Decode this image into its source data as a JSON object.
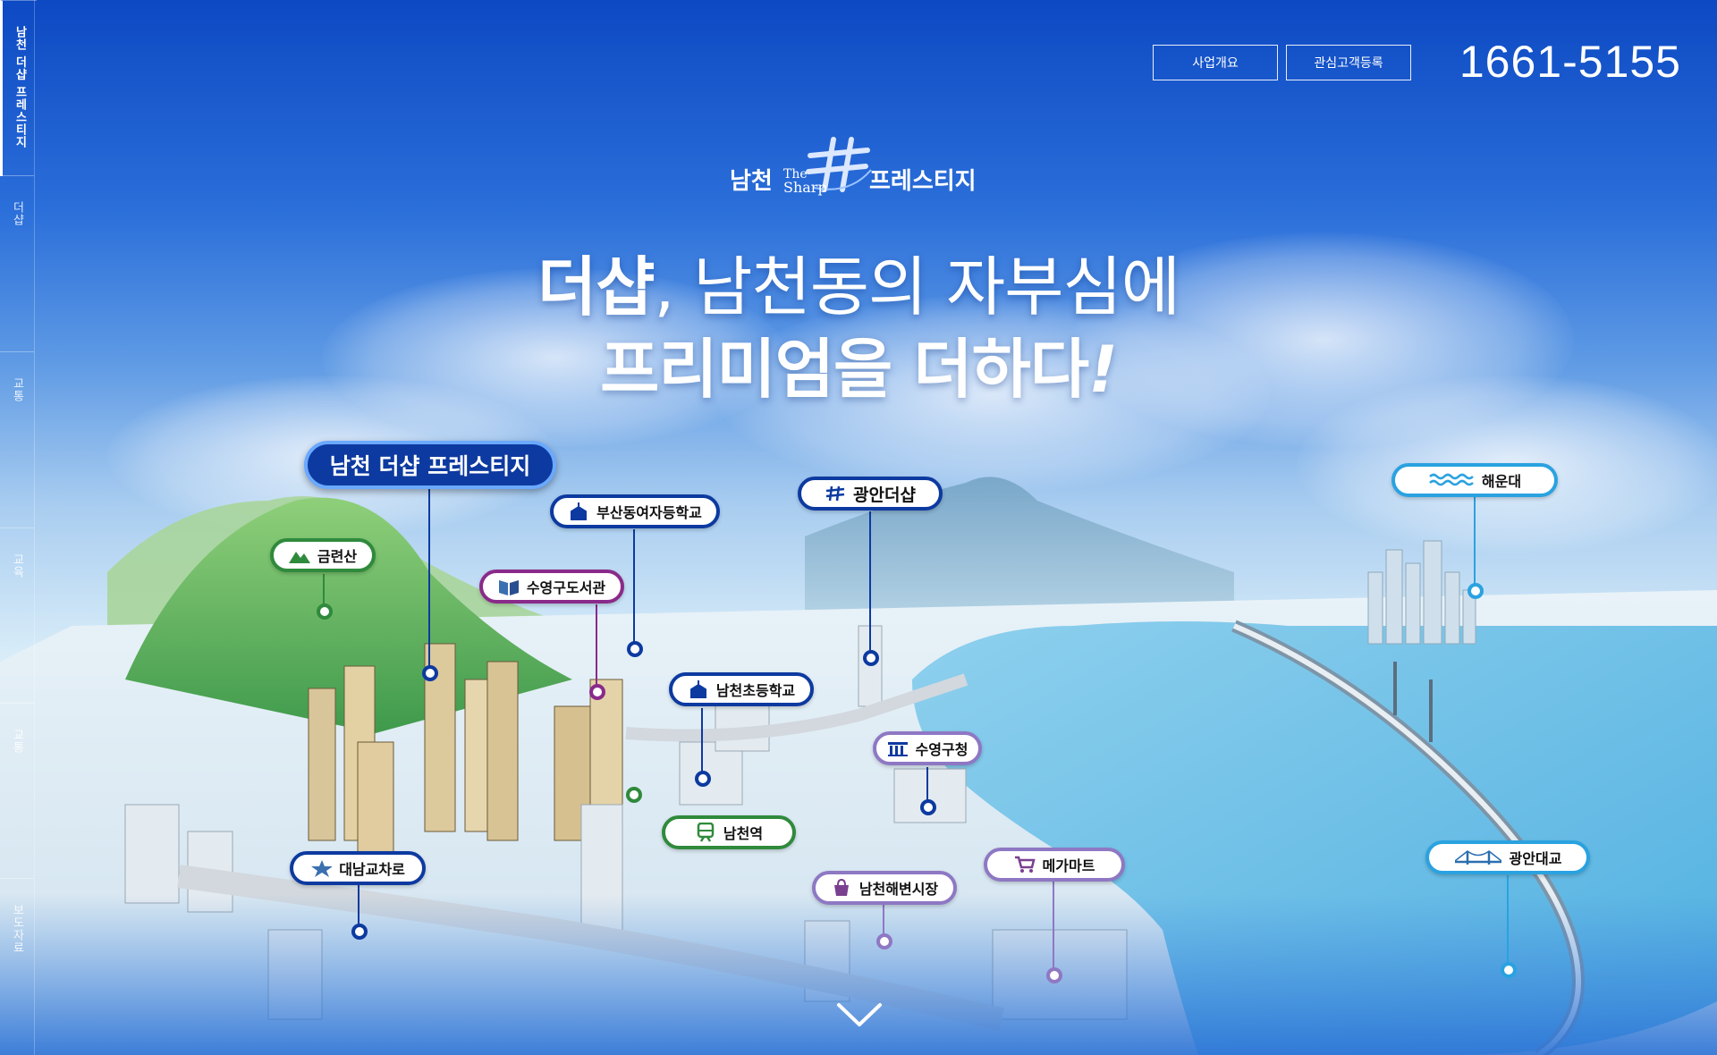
{
  "sidenav": {
    "items": [
      {
        "label": "남천 더샵 프레스티지",
        "active": true
      },
      {
        "label": "더샵",
        "active": false
      },
      {
        "label": "교통",
        "active": false
      },
      {
        "label": "교육",
        "active": false
      },
      {
        "label": "교통",
        "active": false
      },
      {
        "label": "보도자료",
        "active": false
      }
    ]
  },
  "header": {
    "btn_overview": "사업개요",
    "btn_register": "관심고객등록",
    "phone": "1661-5155"
  },
  "logo": {
    "left": "남천",
    "the": "The",
    "sharp": "Sharp",
    "right": "프레스티지"
  },
  "headline": {
    "line1_bold": "더샵",
    "line1_rest": ", 남천동의 자부심에",
    "line2_main": "프리미엄을 더하다",
    "line2_excl": "!"
  },
  "map_labels": {
    "main": "남천 더샵 프레스티지",
    "geumnyeonsan": "금련산",
    "busan_girls_hs": "부산동여자등학교",
    "suyeong_library": "수영구도서관",
    "gwangan_thesharp": "광안더샵",
    "namcheon_elem": "남천초등학교",
    "suyeong_office": "수영구청",
    "namcheon_station": "남천역",
    "daenamgyocharo": "대남교차로",
    "namcheon_market": "남천해변시장",
    "megamart": "메가마트",
    "haeundae": "해운대",
    "gwangan_bridge": "광안대교"
  },
  "icons": {
    "mountain": "mountain-icon",
    "school": "school-icon",
    "book": "book-icon",
    "sharp_logo": "sharp-logo-icon",
    "government": "building-icon",
    "train": "train-icon",
    "interchange": "star-icon",
    "shopping_bag": "bag-icon",
    "cart": "cart-icon",
    "wave": "wave-icon",
    "bridge": "bridge-icon",
    "scroll": "chevron-down-icon"
  },
  "colors": {
    "green": "#2f8a3c",
    "navy": "#0d3aa0",
    "purple": "#8a2a8a",
    "lavender": "#8e78c4",
    "sky": "#2aa2e0"
  }
}
